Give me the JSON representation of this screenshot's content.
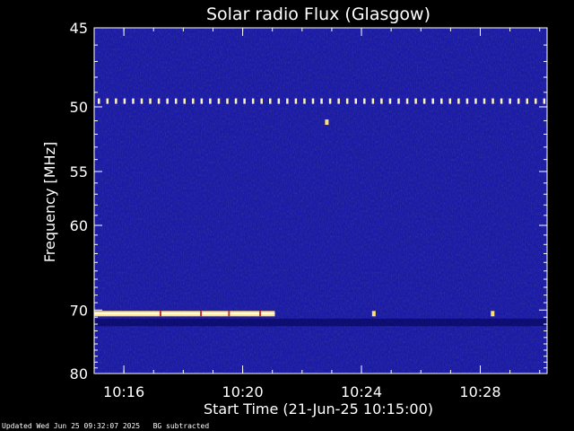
{
  "chart_data": {
    "type": "heatmap",
    "title": "Solar radio Flux (Glasgow)",
    "xlabel": "Start Time (21-Jun-25 10:15:00)",
    "ylabel": "Frequency [MHz]",
    "x_range_minutes": [
      10.25,
      10.25
    ],
    "xlim": [
      "10:15:00",
      "10:30:15"
    ],
    "ylim": [
      80,
      45
    ],
    "y_scale": "reciprocal",
    "x_ticks": [
      "10:16",
      "10:20",
      "10:24",
      "10:28"
    ],
    "y_ticks": [
      45,
      50,
      55,
      60,
      70,
      80
    ],
    "colormap": [
      "#00004a",
      "#1a1aa8",
      "#4a20c0",
      "#c04040",
      "#ffffff"
    ],
    "background_color": "#1a1aa8",
    "features": [
      {
        "name": "periodic interference",
        "freq_mhz": 49.6,
        "time_start": "10:15:00",
        "time_end": "10:30:15",
        "pattern": "dashed"
      },
      {
        "name": "interference band",
        "freq_mhz": 70.5,
        "time_start": "10:15:00",
        "time_end": "10:21:05",
        "pattern": "solid"
      },
      {
        "name": "spike",
        "freq_mhz": 51.1,
        "time": "10:22:50"
      },
      {
        "name": "spike",
        "freq_mhz": 70.5,
        "time": "10:24:25"
      },
      {
        "name": "spike",
        "freq_mhz": 70.5,
        "time": "10:28:25"
      }
    ],
    "grid": false
  },
  "footer": {
    "updated": "Updated Wed Jun 25 09:32:07 2025",
    "note": "BG subtracted"
  }
}
